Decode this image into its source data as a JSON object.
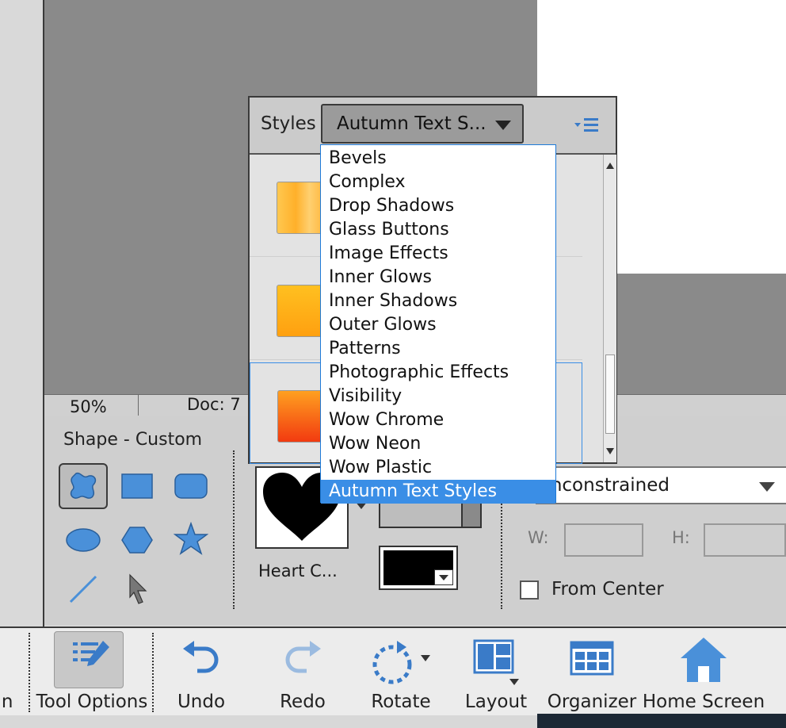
{
  "status_bar": {
    "zoom": "50%",
    "doc_info": "Doc: 7"
  },
  "tool_options": {
    "title": "Shape - Custom",
    "shape_name": "Heart C...",
    "geometry_select": "Unconstrained",
    "width_label": "W:",
    "height_label": "H:",
    "from_center_label": "From Center"
  },
  "styles_panel": {
    "title": "Styles",
    "selected_library": "Autumn Text S...",
    "library_options": [
      "Bevels",
      "Complex",
      "Drop Shadows",
      "Glass Buttons",
      "Image Effects",
      "Inner Glows",
      "Inner Shadows",
      "Outer Glows",
      "Patterns",
      "Photographic Effects",
      "Visibility",
      "Wow Chrome",
      "Wow Neon",
      "Wow Plastic",
      "Autumn Text Styles"
    ],
    "highlighted_option": "Autumn Text Styles"
  },
  "taskbar": {
    "partial_label": "in",
    "tool_options": "Tool Options",
    "undo": "Undo",
    "redo": "Redo",
    "rotate": "Rotate",
    "layout": "Layout",
    "organizer": "Organizer",
    "home_screen": "Home Screen"
  },
  "colors": {
    "accent_blue": "#3a8ee6",
    "icon_blue": "#4a90d9",
    "shape_color": "#e53a1e"
  }
}
